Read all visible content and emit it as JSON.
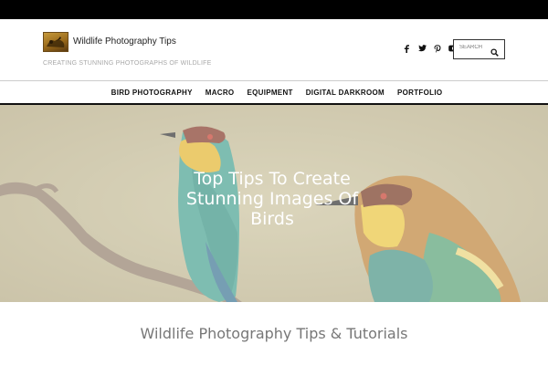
{
  "site": {
    "title": "Wildlife Photography Tips",
    "tagline": "CREATING STUNNING PHOTOGRAPHS OF WILDLIFE",
    "logo_icon": "bird-photo-logo-icon"
  },
  "social": {
    "icons": [
      "facebook-icon",
      "twitter-icon",
      "pinterest-icon",
      "youtube-icon"
    ]
  },
  "search": {
    "placeholder": "SEARCH",
    "icon": "search-icon"
  },
  "nav": {
    "items": [
      {
        "label": "BIRD PHOTOGRAPHY"
      },
      {
        "label": "MACRO"
      },
      {
        "label": "EQUIPMENT"
      },
      {
        "label": "DIGITAL DARKROOM"
      },
      {
        "label": "PORTFOLIO"
      }
    ]
  },
  "hero": {
    "title": "Top Tips To Create Stunning Images Of Birds"
  },
  "main": {
    "section_title": "Wildlife Photography Tips & Tutorials"
  },
  "colors": {
    "topbar": "#000000",
    "nav_border": "#111111",
    "tagline": "#a8a8a8",
    "section_title": "#777777"
  }
}
